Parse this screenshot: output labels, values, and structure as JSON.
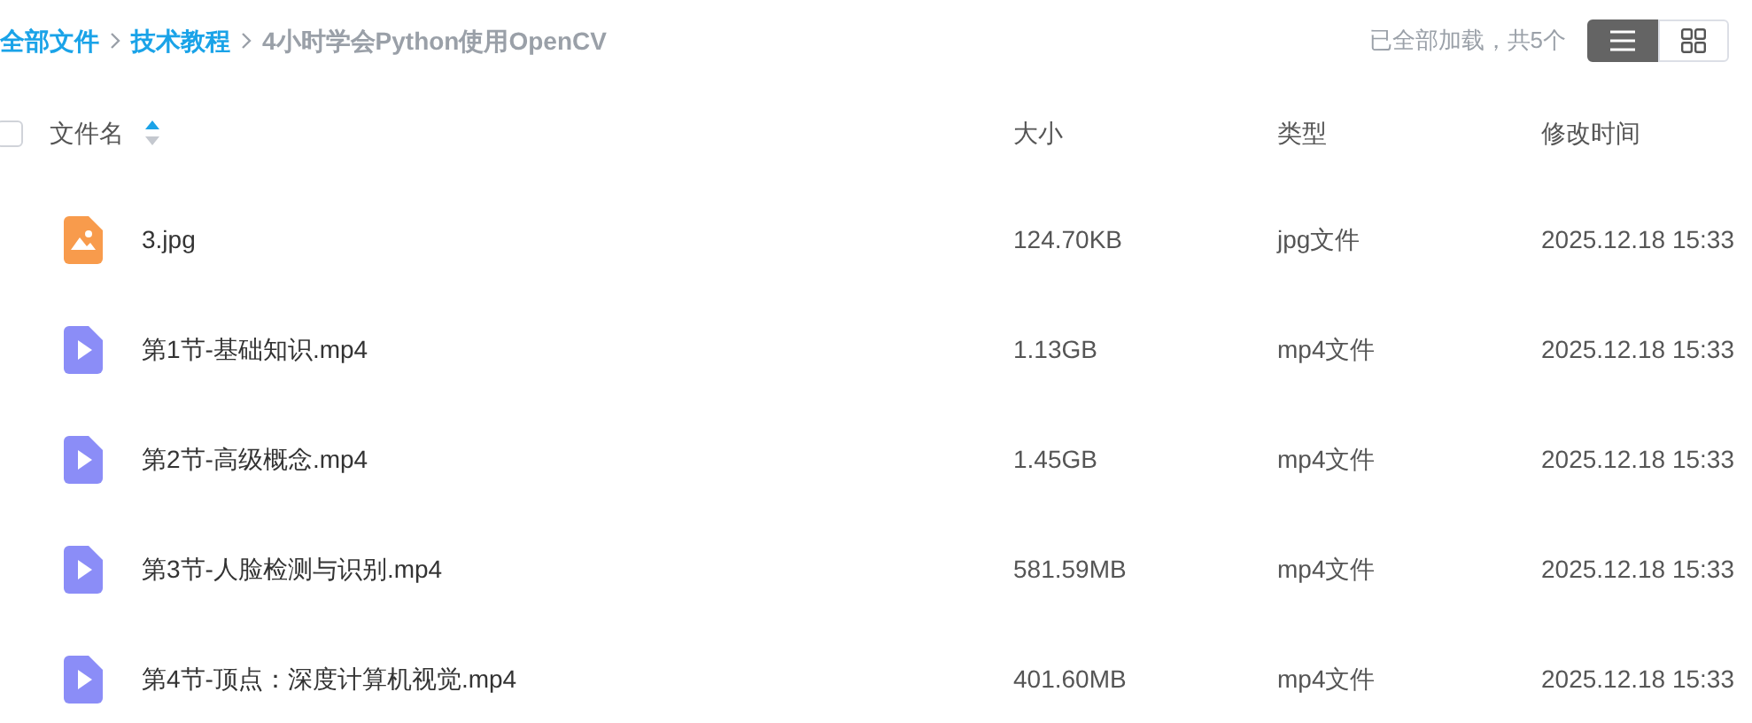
{
  "breadcrumb": [
    {
      "label": "全部文件",
      "kind": "link"
    },
    {
      "label": "技术教程",
      "kind": "link"
    },
    {
      "label": "4小时学会Python使用OpenCV",
      "kind": "current"
    }
  ],
  "load_status": "已全部加载，共5个",
  "view_toggle": [
    {
      "kind": "list",
      "selected": true
    },
    {
      "kind": "grid",
      "selected": false
    }
  ],
  "select_all": {
    "checked": false
  },
  "columns": [
    {
      "label": "文件名",
      "sorted": true,
      "ascending": true
    },
    {
      "label": "大小",
      "sorted": false
    },
    {
      "label": "类型",
      "sorted": false
    },
    {
      "label": "修改时间",
      "sorted": false
    }
  ],
  "rows": [
    {
      "kind": "image",
      "name": "3.jpg",
      "size": "124.70KB",
      "type": "jpg文件",
      "modified": "2025.12.18 15:33"
    },
    {
      "kind": "video",
      "name": "第1节-基础知识.mp4",
      "size": "1.13GB",
      "type": "mp4文件",
      "modified": "2025.12.18 15:33"
    },
    {
      "kind": "video",
      "name": "第2节-高级概念.mp4",
      "size": "1.45GB",
      "type": "mp4文件",
      "modified": "2025.12.18 15:33"
    },
    {
      "kind": "video",
      "name": "第3节-人脸检测与识别.mp4",
      "size": "581.59MB",
      "type": "mp4文件",
      "modified": "2025.12.18 15:33"
    },
    {
      "kind": "video",
      "name": "第4节-顶点：深度计算机视觉.mp4",
      "size": "401.60MB",
      "type": "mp4文件",
      "modified": "2025.12.18 15:33"
    }
  ]
}
